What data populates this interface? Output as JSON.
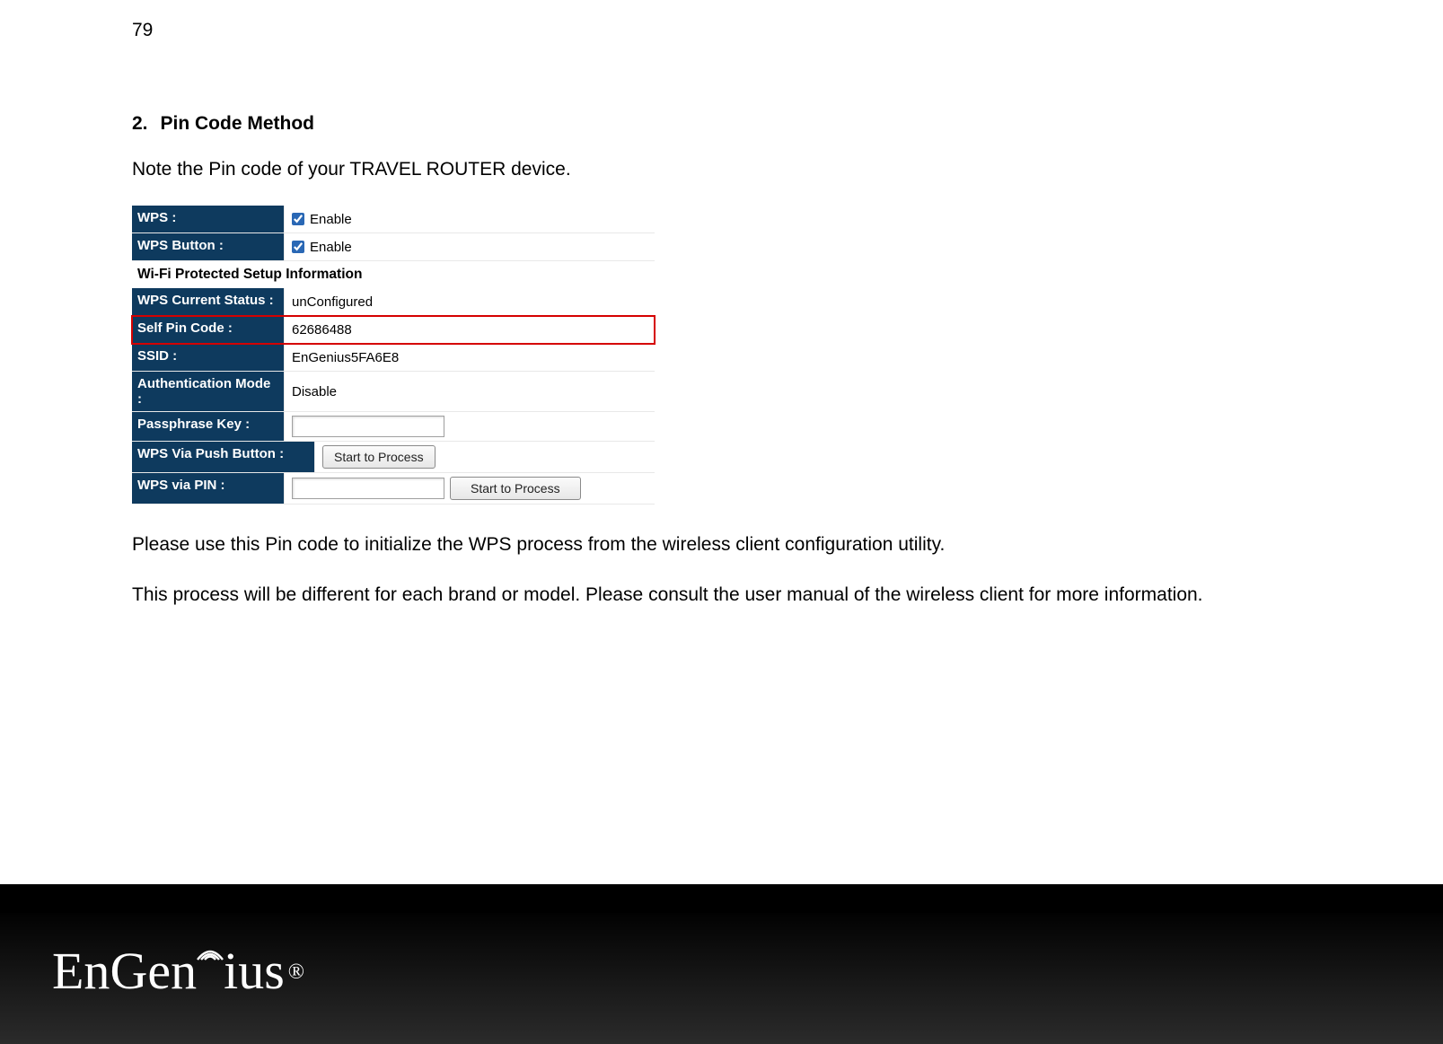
{
  "page_number": "79",
  "heading_number": "2.",
  "heading_text": "Pin Code Method",
  "intro_text": "Note the Pin code of your TRAVEL ROUTER device.",
  "panel": {
    "wps_label": "WPS :",
    "wps_enable_text": "Enable",
    "wps_button_label": "WPS Button :",
    "wps_button_enable_text": "Enable",
    "section_header": "Wi-Fi Protected Setup Information",
    "status_label": "WPS Current Status :",
    "status_value": "unConfigured",
    "pin_label": "Self Pin Code :",
    "pin_value": "62686488",
    "ssid_label": "SSID :",
    "ssid_value": "EnGenius5FA6E8",
    "auth_label": "Authentication Mode :",
    "auth_value": "Disable",
    "pass_label": "Passphrase Key :",
    "push_label": "WPS Via Push Button :",
    "push_button": "Start to Process",
    "pin_via_label": "WPS via PIN :",
    "pin_via_button": "Start to Process"
  },
  "para1": "Please use this Pin code to initialize the WPS process from the wireless client configuration utility.",
  "para2": "This process will be different for each brand or model. Please consult the user manual of the wireless client for more information.",
  "brand": {
    "en": "En",
    "gen": "Gen",
    "ius": "ius",
    "reg": "®"
  }
}
